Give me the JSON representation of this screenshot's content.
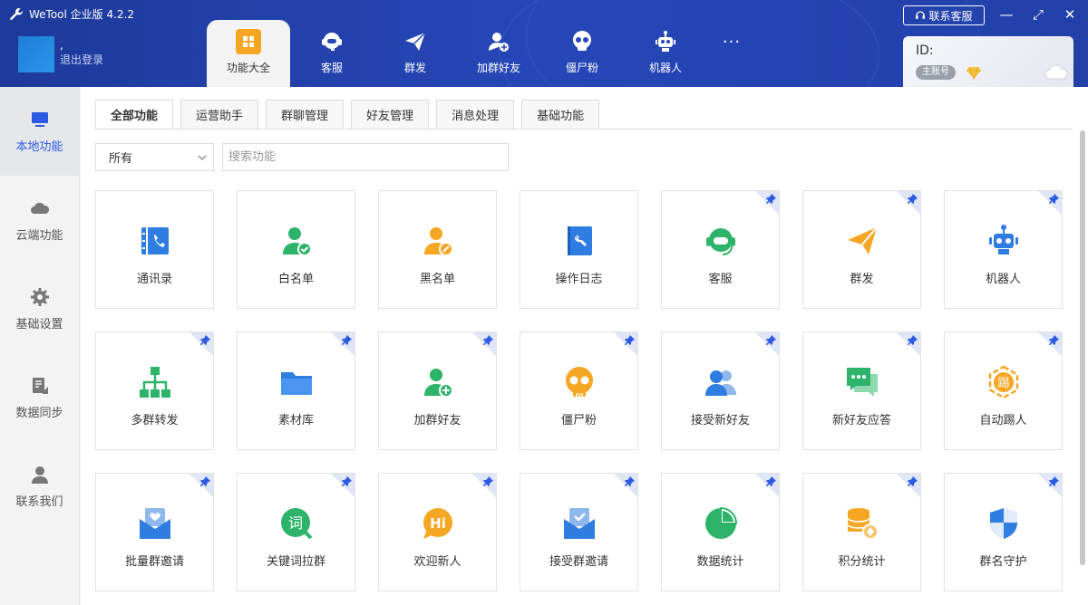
{
  "app": {
    "title": "WeTool 企业版 4.2.2"
  },
  "user": {
    "name": ",",
    "logout": "退出登录"
  },
  "top_tabs": [
    {
      "label": "功能大全",
      "icon": "grid-icon",
      "active": true
    },
    {
      "label": "客服",
      "icon": "headset-icon"
    },
    {
      "label": "群发",
      "icon": "paper-plane-icon"
    },
    {
      "label": "加群好友",
      "icon": "user-add-icon"
    },
    {
      "label": "僵尸粉",
      "icon": "skull-icon"
    },
    {
      "label": "机器人",
      "icon": "robot-icon"
    }
  ],
  "more_label": "···",
  "contact_button": "联系客服",
  "window": {
    "minimize": "—",
    "maximize": "⤢",
    "close": "✕"
  },
  "account": {
    "id_label": "ID:",
    "badge": "主账号"
  },
  "sidebar": [
    {
      "label": "本地功能",
      "icon": "monitor-icon",
      "active": true
    },
    {
      "label": "云端功能",
      "icon": "cloud-icon"
    },
    {
      "label": "基础设置",
      "icon": "gear-icon"
    },
    {
      "label": "数据同步",
      "icon": "sync-icon"
    },
    {
      "label": "联系我们",
      "icon": "person-icon"
    }
  ],
  "sub_tabs": [
    {
      "label": "全部功能",
      "active": true
    },
    {
      "label": "运营助手"
    },
    {
      "label": "群聊管理"
    },
    {
      "label": "好友管理"
    },
    {
      "label": "消息处理"
    },
    {
      "label": "基础功能"
    }
  ],
  "filter": {
    "selected": "所有"
  },
  "search": {
    "placeholder": "搜索功能"
  },
  "cards": [
    {
      "label": "通讯录",
      "icon": "contacts-book-icon",
      "pinned": false
    },
    {
      "label": "白名单",
      "icon": "user-check-icon",
      "pinned": false
    },
    {
      "label": "黑名单",
      "icon": "user-block-icon",
      "pinned": false
    },
    {
      "label": "操作日志",
      "icon": "log-book-icon",
      "pinned": false
    },
    {
      "label": "客服",
      "icon": "headset-icon",
      "pinned": true
    },
    {
      "label": "群发",
      "icon": "paper-plane-icon",
      "pinned": true
    },
    {
      "label": "机器人",
      "icon": "robot-icon",
      "pinned": true
    },
    {
      "label": "多群转发",
      "icon": "org-tree-icon",
      "pinned": true
    },
    {
      "label": "素材库",
      "icon": "folder-icon",
      "pinned": true
    },
    {
      "label": "加群好友",
      "icon": "user-add-icon",
      "pinned": true
    },
    {
      "label": "僵尸粉",
      "icon": "skull-icon",
      "pinned": true
    },
    {
      "label": "接受新好友",
      "icon": "users-icon",
      "pinned": true
    },
    {
      "label": "新好友应答",
      "icon": "chat-bubbles-icon",
      "pinned": true
    },
    {
      "label": "自动踢人",
      "icon": "kick-badge-icon",
      "pinned": true
    },
    {
      "label": "批量群邀请",
      "icon": "mail-heart-icon",
      "pinned": true
    },
    {
      "label": "关键词拉群",
      "icon": "keyword-search-icon",
      "pinned": true
    },
    {
      "label": "欢迎新人",
      "icon": "hi-bubble-icon",
      "pinned": true
    },
    {
      "label": "接受群邀请",
      "icon": "mail-check-icon",
      "pinned": true
    },
    {
      "label": "数据统计",
      "icon": "pie-chart-icon",
      "pinned": true
    },
    {
      "label": "积分统计",
      "icon": "coins-icon",
      "pinned": true
    },
    {
      "label": "群名守护",
      "icon": "shield-icon",
      "pinned": true
    }
  ],
  "card_icon_text": {
    "keyword": "词",
    "hi": "Hi",
    "kick": "踢"
  }
}
